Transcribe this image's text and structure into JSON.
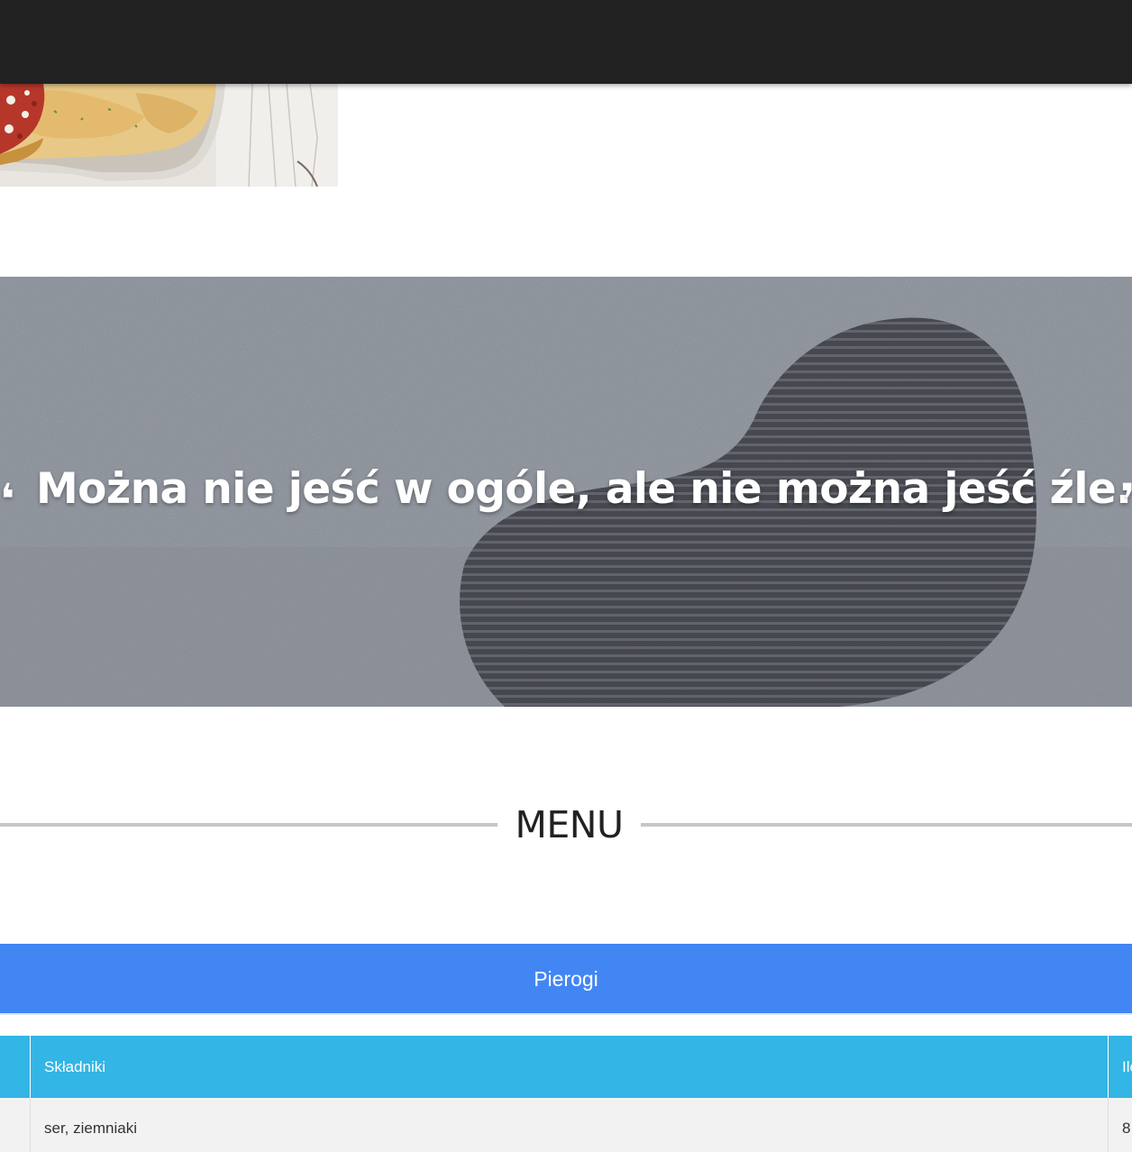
{
  "quote": {
    "open_mark": "❛",
    "text": "Można nie jeść w ogóle, ale nie można jeść źle.",
    "close_mark": "❜"
  },
  "menu": {
    "title": "MENU",
    "category": "Pierogi",
    "table": {
      "headers": [
        "",
        "Składniki",
        "Ilość"
      ],
      "rows": [
        {
          "col0": "",
          "skladniki": "ser, ziemniaki",
          "ilosc": "8"
        }
      ]
    }
  },
  "colors": {
    "topbar": "#212121",
    "category_bar": "#4286f4",
    "table_header": "#33b5e5",
    "row_background": "#f2f2f2",
    "heading_rule": "#c6c6c6"
  }
}
